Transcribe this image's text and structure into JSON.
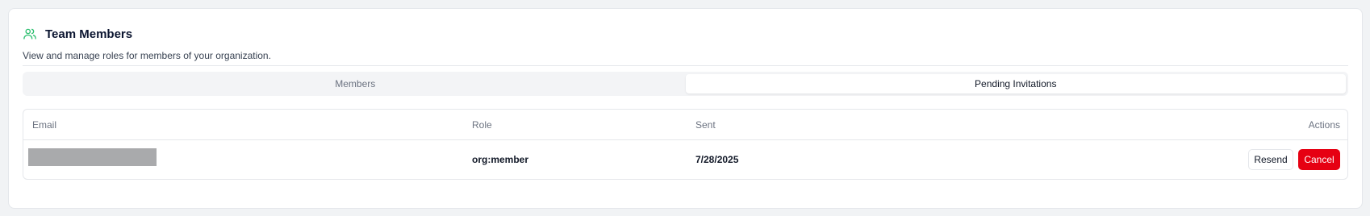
{
  "header": {
    "title": "Team Members",
    "subtitle": "View and manage roles for members of your organization.",
    "icon": "users-icon"
  },
  "tabs": [
    {
      "label": "Members",
      "active": false
    },
    {
      "label": "Pending Invitations",
      "active": true
    }
  ],
  "table": {
    "columns": {
      "email": "Email",
      "role": "Role",
      "sent": "Sent",
      "actions": "Actions"
    },
    "rows": [
      {
        "email": "",
        "email_redacted": true,
        "role": "org:member",
        "sent": "7/28/2025",
        "resend_label": "Resend",
        "cancel_label": "Cancel"
      }
    ]
  },
  "colors": {
    "accent_icon": "#2fbf71",
    "danger": "#e60012"
  }
}
